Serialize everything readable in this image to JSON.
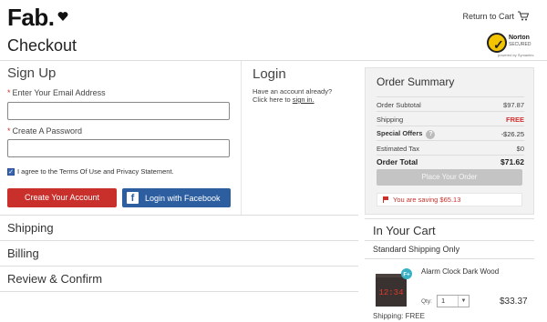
{
  "header": {
    "logo": "Fab.",
    "return_to_cart": "Return to Cart",
    "page_title": "Checkout",
    "norton": {
      "brand": "Norton",
      "secured": "SECURED",
      "powered_by": "powered by Symantec"
    }
  },
  "signup": {
    "title": "Sign Up",
    "email_label": "Enter Your Email Address",
    "email_value": "",
    "password_label": "Create A Password",
    "password_value": "",
    "required_mark": "*",
    "terms": "I agree to the Terms Of Use and Privacy Statement.",
    "create_button": "Create Your Account",
    "facebook_button": "Login with Facebook",
    "facebook_glyph": "f"
  },
  "login": {
    "title": "Login",
    "prompt": "Have an account already?",
    "click_prefix": "Click here to ",
    "link": "sign in."
  },
  "steps": [
    "Shipping",
    "Billing",
    "Review & Confirm"
  ],
  "summary": {
    "title": "Order Summary",
    "rows": [
      {
        "label": "Order Subtotal",
        "value": "$97.87"
      },
      {
        "label": "Shipping",
        "value": "FREE"
      },
      {
        "label": "Special Offers",
        "value": "-$26.25"
      },
      {
        "label": "Estimated Tax",
        "value": "$0"
      },
      {
        "label": "Order Total",
        "value": "$71.62"
      }
    ],
    "help_glyph": "?",
    "place_order": "Place Your Order",
    "saving": "You are saving $65.13"
  },
  "cart": {
    "title": "In Your Cart",
    "shipping_group": "Standard Shipping Only",
    "item": {
      "name": "Alarm Clock Dark Wood",
      "display": "12:34",
      "badge": "F+",
      "qty_label": "Qty:",
      "qty": "1",
      "price": "$33.37",
      "shipping_label": "Shipping:",
      "shipping_value": "FREE"
    }
  },
  "colors": {
    "accent_red": "#c9302c",
    "facebook_blue": "#2d5fa0",
    "disabled_gray": "#c4c4c4"
  }
}
